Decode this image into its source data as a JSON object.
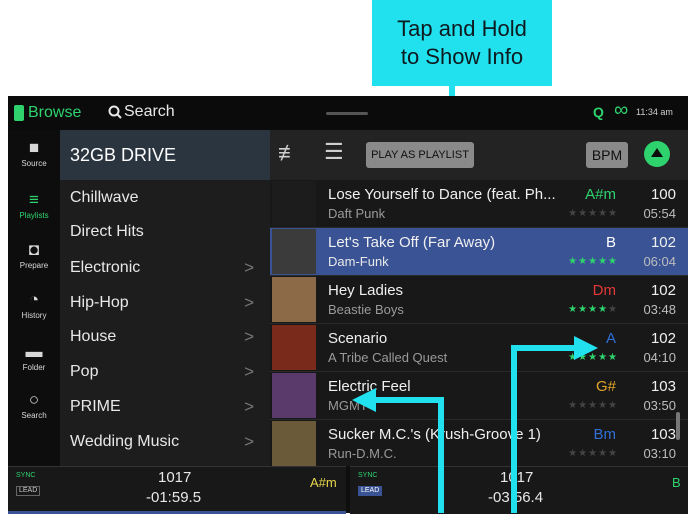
{
  "callout": {
    "line1": "Tap and Hold",
    "line2": "to Show Info",
    "color": "#22e1ee"
  },
  "topbar": {
    "browse": "Browse",
    "search": "Search",
    "quantize": "Q",
    "time": "11:34 am"
  },
  "nav": [
    {
      "label": "Source",
      "icon": "drive-icon"
    },
    {
      "label": "Playlists",
      "icon": "playlist-icon",
      "active": true
    },
    {
      "label": "Prepare",
      "icon": "prepare-icon"
    },
    {
      "label": "History",
      "icon": "clock-icon"
    },
    {
      "label": "Folder",
      "icon": "folder-icon"
    },
    {
      "label": "Search",
      "icon": "search-icon"
    }
  ],
  "crates": {
    "header": "32GB DRIVE",
    "items": [
      "Chillwave",
      "Direct Hits",
      "Electronic",
      "Hip-Hop",
      "House",
      "Pop",
      "PRIME",
      "Wedding Music"
    ]
  },
  "toolbar": {
    "play_as_playlist": "PLAY AS PLAYLIST",
    "bpm": "BPM"
  },
  "tracks": [
    {
      "title": "Lose Yourself to Dance (feat. Ph...",
      "artist": "Daft Punk",
      "key": "A#m",
      "key_color": "#2ed36e",
      "stars": 0,
      "bpm": "100",
      "time": "05:54",
      "art": "#1c1c1c"
    },
    {
      "title": "Let's Take Off (Far Away)",
      "artist": "Dam-Funk",
      "key": "B",
      "key_color": "#ffffff",
      "stars": 5,
      "bpm": "102",
      "time": "06:04",
      "art": "#3b3b3b",
      "selected": true
    },
    {
      "title": "Hey Ladies",
      "artist": "Beastie Boys",
      "key": "Dm",
      "key_color": "#e23838",
      "stars": 4,
      "bpm": "102",
      "time": "03:48",
      "art": "#8c6a48"
    },
    {
      "title": "Scenario",
      "artist": "A Tribe Called Quest",
      "key": "A",
      "key_color": "#2f6fd6",
      "stars": 5,
      "bpm": "102",
      "time": "04:10",
      "art": "#7a2a1a"
    },
    {
      "title": "Electric Feel",
      "artist": "MGMT",
      "key": "G#",
      "key_color": "#e3a52a",
      "stars": 0,
      "bpm": "103",
      "time": "03:50",
      "art": "#5a3a6a"
    },
    {
      "title": "Sucker M.C.'s (Krush-Groove 1)",
      "artist": "Run-D.M.C.",
      "key": "Bm",
      "key_color": "#2f6fd6",
      "stars": 0,
      "bpm": "103",
      "time": "03:10",
      "art": "#6a5a3a"
    }
  ],
  "decks": [
    {
      "sync": "SYNC",
      "lead": "LEAD",
      "bpm": "1017",
      "time": "-01:59.5",
      "key": "A#m"
    },
    {
      "sync": "SYNC",
      "lead": "LEAD",
      "bpm": "1017",
      "time": "-03:56.4",
      "key": "B"
    }
  ]
}
